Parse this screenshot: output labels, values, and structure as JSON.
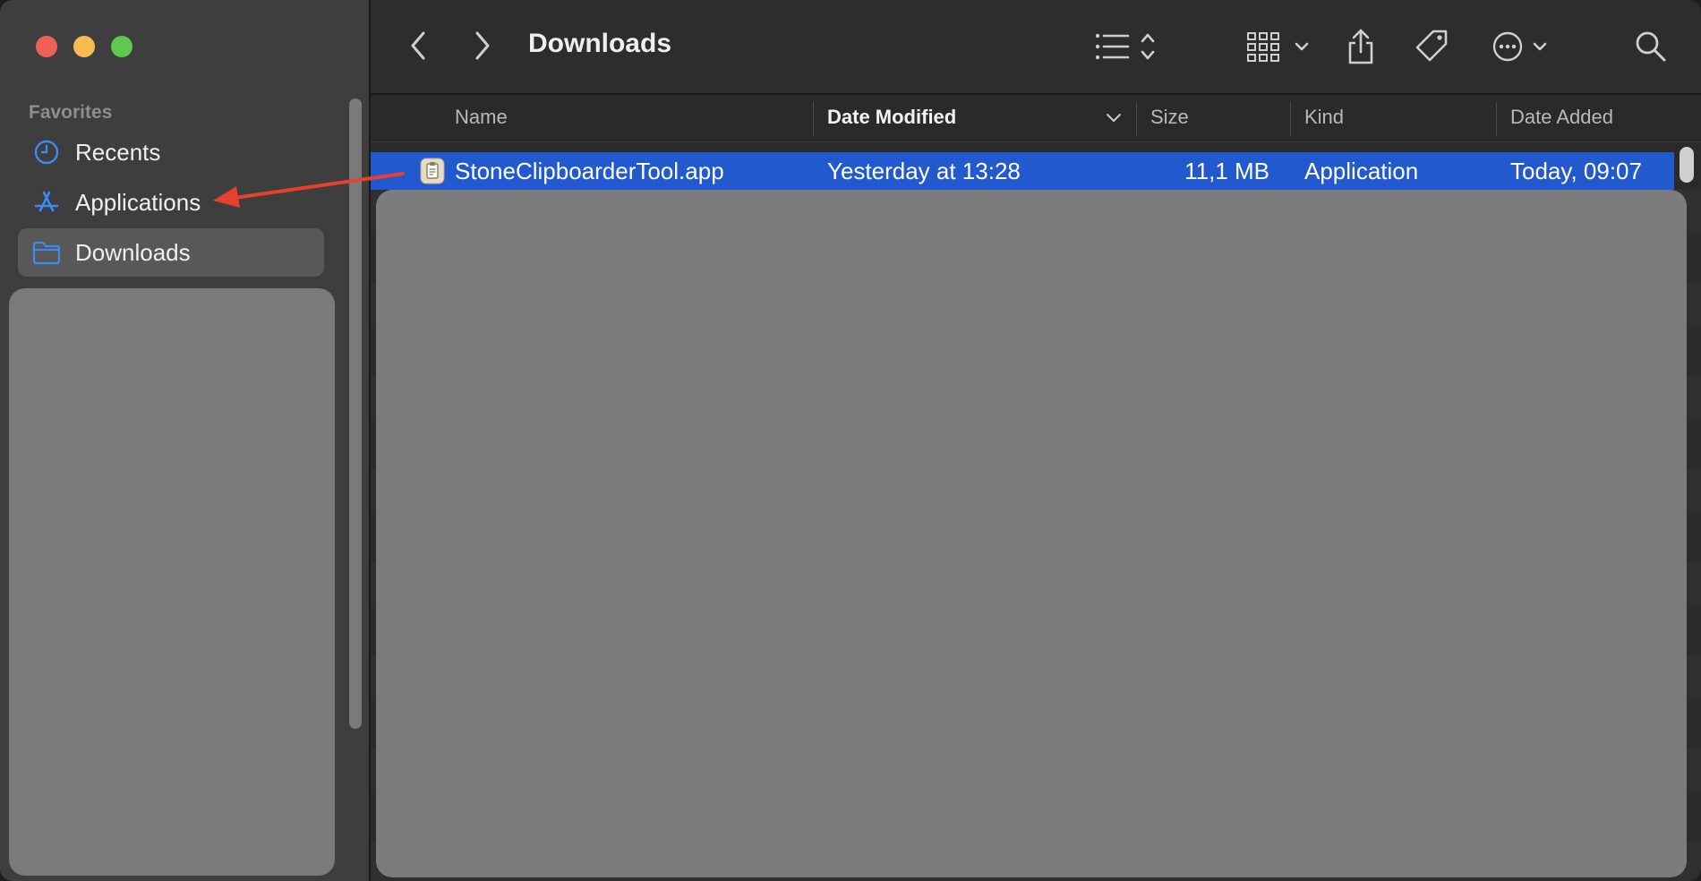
{
  "window": {
    "title": "Downloads"
  },
  "sidebar": {
    "heading": "Favorites",
    "items": [
      {
        "label": "Recents",
        "icon": "clock-icon",
        "selected": false
      },
      {
        "label": "Applications",
        "icon": "app-store-icon",
        "selected": false
      },
      {
        "label": "Downloads",
        "icon": "folder-icon",
        "selected": true
      }
    ]
  },
  "toolbar": {
    "title": "Downloads",
    "icons": [
      "back-icon",
      "forward-icon",
      "list-view-icon",
      "grid-view-icon",
      "share-icon",
      "tag-icon",
      "more-icon",
      "search-icon"
    ]
  },
  "columns": {
    "name": "Name",
    "date_modified": "Date Modified",
    "size": "Size",
    "kind": "Kind",
    "date_added": "Date Added"
  },
  "files": [
    {
      "name": "StoneClipboarderTool.app",
      "date_modified": "Yesterday at 13:28",
      "size": "11,1 MB",
      "kind": "Application",
      "date_added": "Today, 09:07"
    }
  ],
  "colors": {
    "selection": "#2359cf",
    "accent": "#3b8bf5",
    "annotation_arrow": "#e8402e",
    "redaction": "#7b7b7b"
  }
}
